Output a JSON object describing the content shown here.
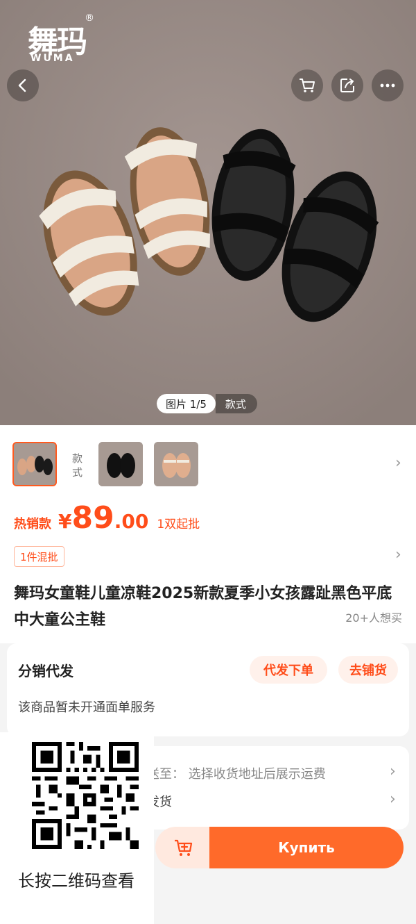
{
  "brand": {
    "name_zh": "舞玛",
    "name_en": "WUMA",
    "reg": "®"
  },
  "gallery": {
    "counter": "图片 1/5",
    "style_tab": "款式"
  },
  "variants": {
    "style_label": "款式"
  },
  "price": {
    "hot_label": "热销款",
    "currency": "¥",
    "integer": "89",
    "decimal": ".00",
    "moq": "1双起批"
  },
  "mix_tag": "1件混批",
  "product": {
    "title": "舞玛女童鞋儿童凉鞋2025新款夏季小女孩露趾黑色平底中大童公主鞋",
    "wants": "20+人想买"
  },
  "distribution": {
    "heading": "分销代发",
    "btn_dropship": "代发下单",
    "btn_shop": "去铺货",
    "note": "该商品暂未开通面单服务"
  },
  "shipping": {
    "row1": "送至：  选择收货地址后展示运费",
    "row2": "发货"
  },
  "qr": {
    "caption": "长按二维码查看"
  },
  "actions": {
    "buy": "Купить"
  },
  "colors": {
    "accent": "#ff4d1a",
    "buy_bg": "#ff6a2a",
    "pill_bg": "#fff1eb"
  }
}
